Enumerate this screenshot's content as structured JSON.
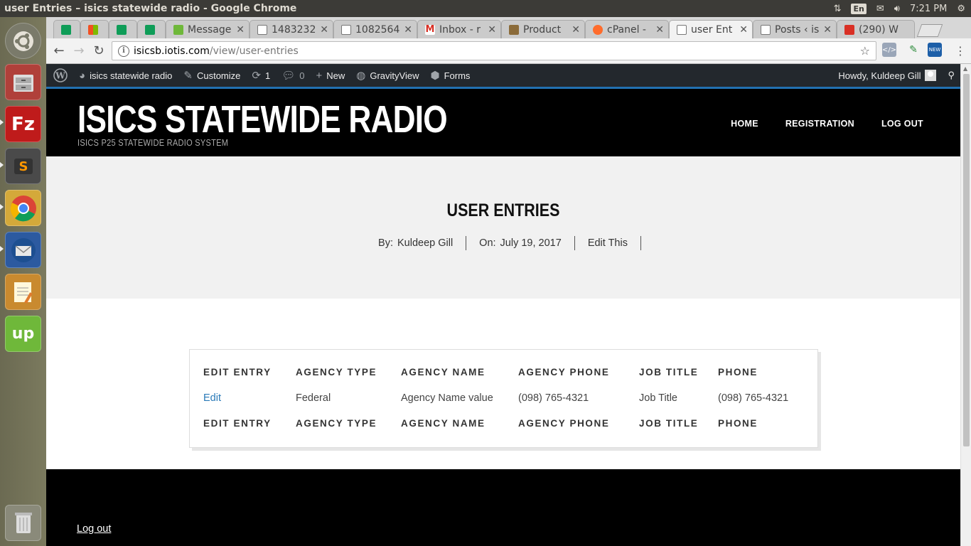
{
  "topbar": {
    "window_title": "user Entries – isics statewide radio - Google Chrome",
    "lang": "En",
    "time": "7:21 PM"
  },
  "launcher": {
    "items": [
      "ubuntu-dash",
      "files",
      "filezilla",
      "sublime-text",
      "chrome",
      "thunderbird",
      "text-editor",
      "upwork",
      "trash"
    ]
  },
  "browser": {
    "tabs": [
      {
        "label": "",
        "icon": "sheets-icon"
      },
      {
        "label": "",
        "icon": "windows-icon"
      },
      {
        "label": "",
        "icon": "sheets-icon"
      },
      {
        "label": "",
        "icon": "sheets-icon"
      },
      {
        "label": "Message",
        "icon": "upwork-icon"
      },
      {
        "label": "1483232",
        "icon": "document-icon"
      },
      {
        "label": "1082564",
        "icon": "document-icon"
      },
      {
        "label": "Inbox - r",
        "icon": "gmail-icon"
      },
      {
        "label": "Product",
        "icon": "product-icon"
      },
      {
        "label": "cPanel -",
        "icon": "cpanel-icon"
      },
      {
        "label": "user Ent",
        "icon": "document-icon"
      },
      {
        "label": "Posts ‹ is",
        "icon": "document-icon"
      },
      {
        "label": "(290) W",
        "icon": "notification-icon"
      }
    ],
    "url_host": "isicsb.iotis.com",
    "url_path": "/view/user-entries"
  },
  "wpbar": {
    "site_name": "isics statewide radio",
    "customize": "Customize",
    "updates_count": "1",
    "comments_count": "0",
    "new_label": "New",
    "gravityview": "GravityView",
    "forms": "Forms",
    "howdy": "Howdy, Kuldeep Gill"
  },
  "site": {
    "title": "ISICS STATEWIDE RADIO",
    "tagline": "ISICS P25 STATEWIDE RADIO SYSTEM",
    "nav": [
      "HOME",
      "REGISTRATION",
      "LOG OUT"
    ]
  },
  "page": {
    "title": "USER ENTRIES",
    "by_label": "By:",
    "author": "Kuldeep Gill",
    "on_label": "On:",
    "date": "July 19, 2017",
    "edit_this": "Edit This"
  },
  "table": {
    "headers": [
      "EDIT ENTRY",
      "AGENCY TYPE",
      "AGENCY NAME",
      "AGENCY PHONE",
      "JOB TITLE",
      "PHONE"
    ],
    "rows": [
      [
        "Edit",
        "Federal",
        "Agency Name value",
        "(098) 765-4321",
        "Job Title",
        "(098) 765-4321"
      ]
    ]
  },
  "footer": {
    "logout": "Log out"
  }
}
